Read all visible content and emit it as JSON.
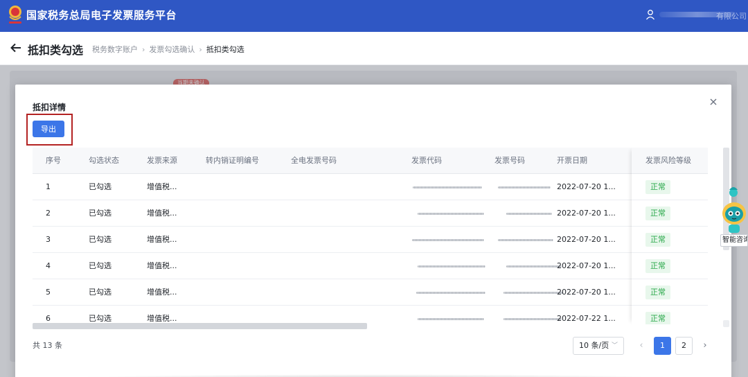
{
  "header": {
    "site_title": "国家税务总局电子发票服务平台",
    "user_name": "有限公司"
  },
  "subbar": {
    "page_title": "抵扣类勾选",
    "breadcrumb": [
      "税务数字账户",
      "发票勾选确认",
      "抵扣类勾选"
    ]
  },
  "background": {
    "badge": "当期未确认"
  },
  "dialog": {
    "title": "抵扣详情",
    "export_label": "导出",
    "columns": [
      "序号",
      "勾选状态",
      "发票来源",
      "转内销证明编号",
      "全电发票号码",
      "发票代码",
      "发票号码",
      "开票日期",
      "发票风险等级"
    ],
    "rows": [
      {
        "seq": "1",
        "status": "已勾选",
        "source": "增值税...",
        "date": "2022-07-20 1...",
        "risk": "正常"
      },
      {
        "seq": "2",
        "status": "已勾选",
        "source": "增值税...",
        "date": "2022-07-20 1...",
        "risk": "正常"
      },
      {
        "seq": "3",
        "status": "已勾选",
        "source": "增值税...",
        "date": "2022-07-20 1...",
        "risk": "正常"
      },
      {
        "seq": "4",
        "status": "已勾选",
        "source": "增值税...",
        "date": "2022-07-20 1...",
        "risk": "正常"
      },
      {
        "seq": "5",
        "status": "已勾选",
        "source": "增值税...",
        "date": "2022-07-20 1...",
        "risk": "正常"
      },
      {
        "seq": "6",
        "status": "已勾选",
        "source": "增值税...",
        "date": "2022-07-22 1...",
        "risk": "正常"
      }
    ],
    "total": "共 13 条",
    "page_size": "10 条/页",
    "pages": [
      "1",
      "2"
    ],
    "current_page": "1"
  },
  "assistant": {
    "label": "智能咨询"
  },
  "colors": {
    "header_bg": "#2f57c4",
    "primary": "#3c76e8",
    "highlight_box": "#b32222",
    "tag_green": "#2aa84a"
  },
  "icons": [
    "emblem-icon",
    "user-icon",
    "back-arrow-icon",
    "close-icon",
    "chevron-down-icon",
    "chevron-left-icon",
    "chevron-right-icon",
    "robot-mascot-icon"
  ]
}
